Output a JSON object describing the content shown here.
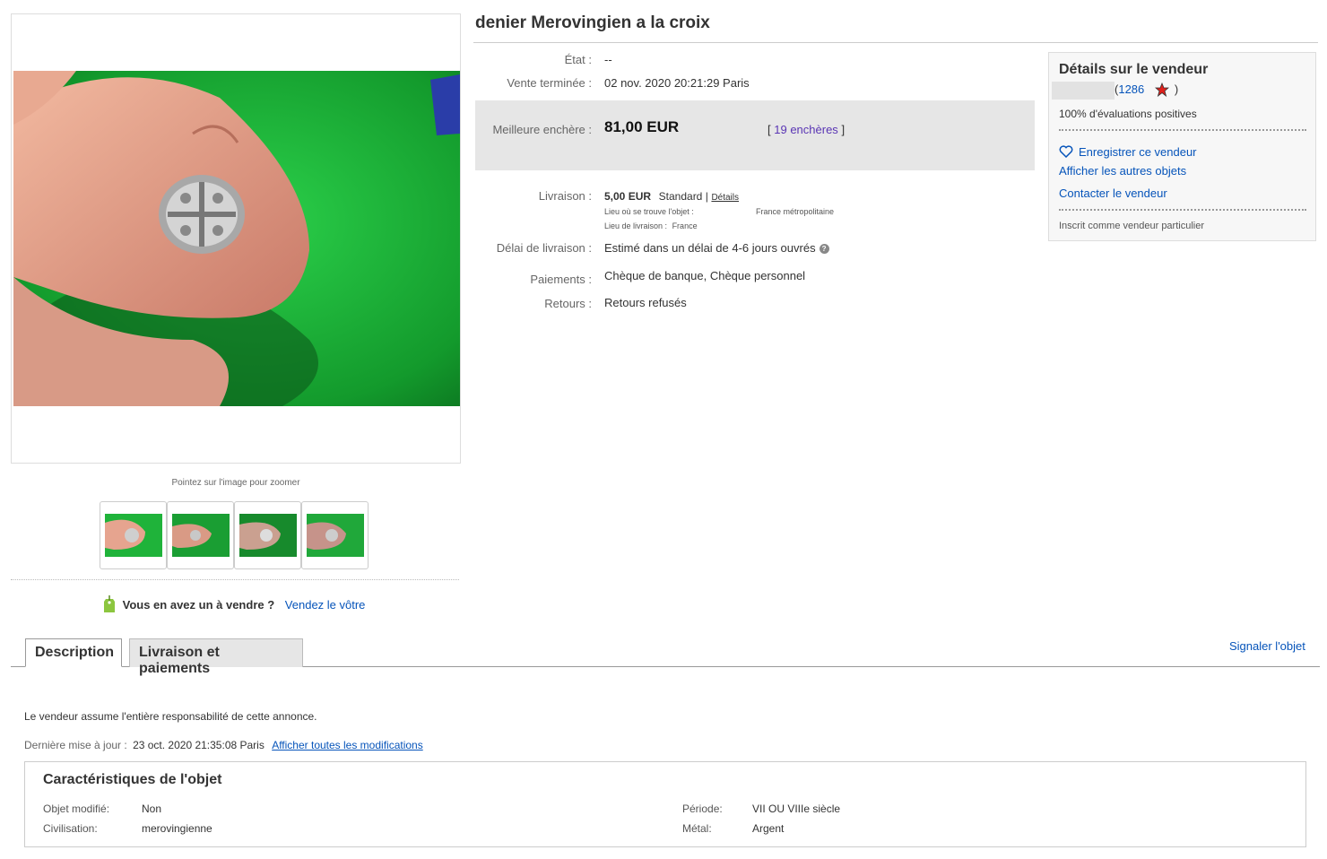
{
  "title": "denier Merovingien a la croix",
  "details": {
    "condition_label": "État :",
    "condition_value": "--",
    "ended_label": "Vente terminée :",
    "ended_value": "02 nov. 2020  20:21:29 Paris",
    "best_bid_label": "Meilleure enchère :",
    "best_bid_value": "81,00 EUR",
    "bids_open": "[",
    "bids_link": "19 enchères",
    "bids_close": "]",
    "shipping_label": "Livraison :",
    "shipping_price": "5,00 EUR",
    "shipping_method": "Standard |",
    "shipping_details_link": "Détails",
    "item_location_label": "Lieu où se trouve l'objet :",
    "item_location_value": "France métropolitaine",
    "ships_to_label": "Lieu de livraison :",
    "ships_to_value": "France",
    "delivery_label": "Délai de livraison :",
    "delivery_value": "Estimé dans un délai de 4-6 jours ouvrés",
    "payments_label": "Paiements :",
    "payments_value": "Chèque de banque, Chèque personnel",
    "returns_label": "Retours :",
    "returns_value": "Retours refusés"
  },
  "seller": {
    "title": "Détails sur le vendeur",
    "score_open": "(",
    "score": "1286",
    "score_close": ")",
    "feedback": "100% d'évaluations positives",
    "save_seller": "Enregistrer ce vendeur",
    "other_items": "Afficher les autres objets",
    "contact": "Contacter le vendeur",
    "registered_as": "Inscrit comme vendeur particulier"
  },
  "gallery": {
    "zoom_hint": "Pointez sur l'image pour zoomer",
    "sell_question": "Vous en avez un à vendre ?",
    "sell_link": "Vendez le vôtre"
  },
  "tabs": {
    "description": "Description",
    "shipping": "Livraison et paiements",
    "report": "Signaler l'objet"
  },
  "description": {
    "responsibility": "Le vendeur assume l'entière responsabilité de cette annonce.",
    "last_update_label": "Dernière mise à jour :",
    "last_update_value": "23 oct. 2020 21:35:08 Paris",
    "all_changes_link": "Afficher toutes les modifications"
  },
  "specs": {
    "title": "Caractéristiques de l'objet",
    "modified_label": "Objet modifié:",
    "modified_value": "Non",
    "civilisation_label": "Civilisation:",
    "civilisation_value": "merovingienne",
    "period_label": "Période:",
    "period_value": "VII OU VIIIe siècle",
    "metal_label": "Métal:",
    "metal_value": "Argent"
  },
  "colors": {
    "link": "#0654ba",
    "bid_link": "#5a35b4",
    "bid_box": "#e6e6e6",
    "photo_green": "#1fb33a"
  },
  "icons": {
    "star": "red-star-icon",
    "heart": "heart-icon",
    "tag": "price-tag-icon",
    "help": "help-icon"
  }
}
